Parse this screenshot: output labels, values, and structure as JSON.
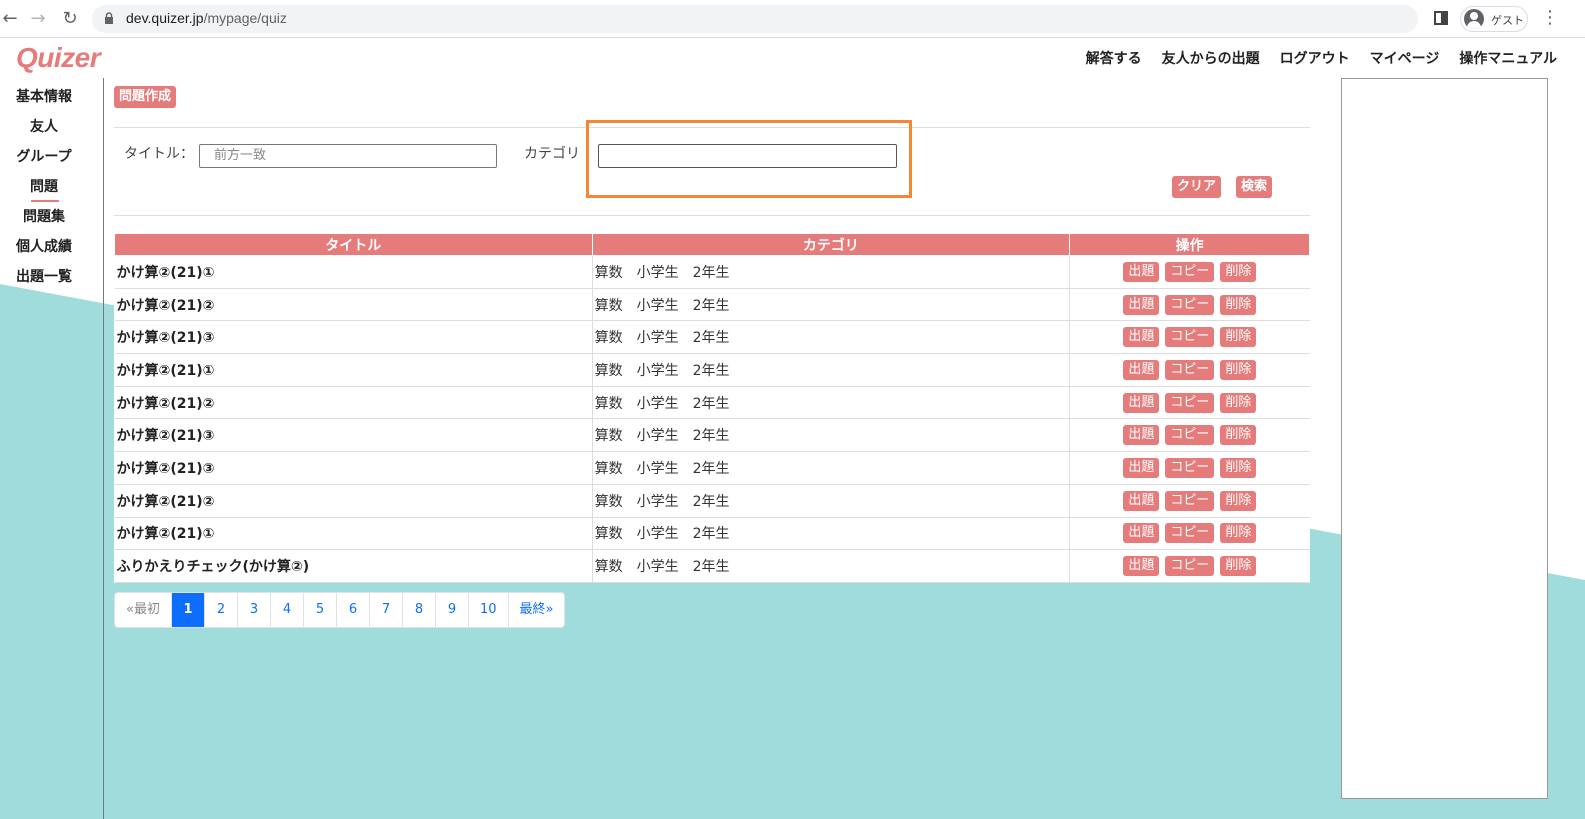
{
  "browser": {
    "url_host": "dev.quizer.jp",
    "url_path": "/mypage/quiz",
    "profile_label": "ゲスト"
  },
  "header": {
    "logo": "Quizer",
    "nav": [
      "解答する",
      "友人からの出題",
      "ログアウト",
      "マイページ",
      "操作マニュアル"
    ]
  },
  "sidebar": {
    "items": [
      {
        "label": "基本情報"
      },
      {
        "label": "友人"
      },
      {
        "label": "グループ"
      },
      {
        "label": "問題",
        "active": true
      },
      {
        "label": "問題集"
      },
      {
        "label": "個人成績"
      },
      {
        "label": "出題一覧"
      }
    ]
  },
  "main": {
    "create_button": "問題作成",
    "filter": {
      "title_label": "タイトル：",
      "title_placeholder": "前方一致",
      "category_label": "カテゴリ",
      "category_value": "",
      "clear_button": "クリア",
      "search_button": "検索"
    },
    "table": {
      "headers": [
        "タイトル",
        "カテゴリ",
        "操作"
      ],
      "ops": [
        "出題",
        "コピー",
        "削除"
      ],
      "rows": [
        {
          "title": "かけ算②(21)①",
          "category": "算数　小学生　2年生"
        },
        {
          "title": "かけ算②(21)②",
          "category": "算数　小学生　2年生"
        },
        {
          "title": "かけ算②(21)③",
          "category": "算数　小学生　2年生"
        },
        {
          "title": "かけ算②(21)①",
          "category": "算数　小学生　2年生"
        },
        {
          "title": "かけ算②(21)②",
          "category": "算数　小学生　2年生"
        },
        {
          "title": "かけ算②(21)③",
          "category": "算数　小学生　2年生"
        },
        {
          "title": "かけ算②(21)③",
          "category": "算数　小学生　2年生"
        },
        {
          "title": "かけ算②(21)②",
          "category": "算数　小学生　2年生"
        },
        {
          "title": "かけ算②(21)①",
          "category": "算数　小学生　2年生"
        },
        {
          "title": "ふりかえりチェック(かけ算②)",
          "category": "算数　小学生　2年生"
        }
      ]
    },
    "pagination": {
      "first": "«最初",
      "pages": [
        "1",
        "2",
        "3",
        "4",
        "5",
        "6",
        "7",
        "8",
        "9",
        "10"
      ],
      "current": "1",
      "last": "最終»"
    }
  },
  "colors": {
    "accent": "#e57b7b",
    "teal_bg": "#a0dcdc",
    "highlight": "#f58634",
    "pager_active": "#0d6efd"
  }
}
